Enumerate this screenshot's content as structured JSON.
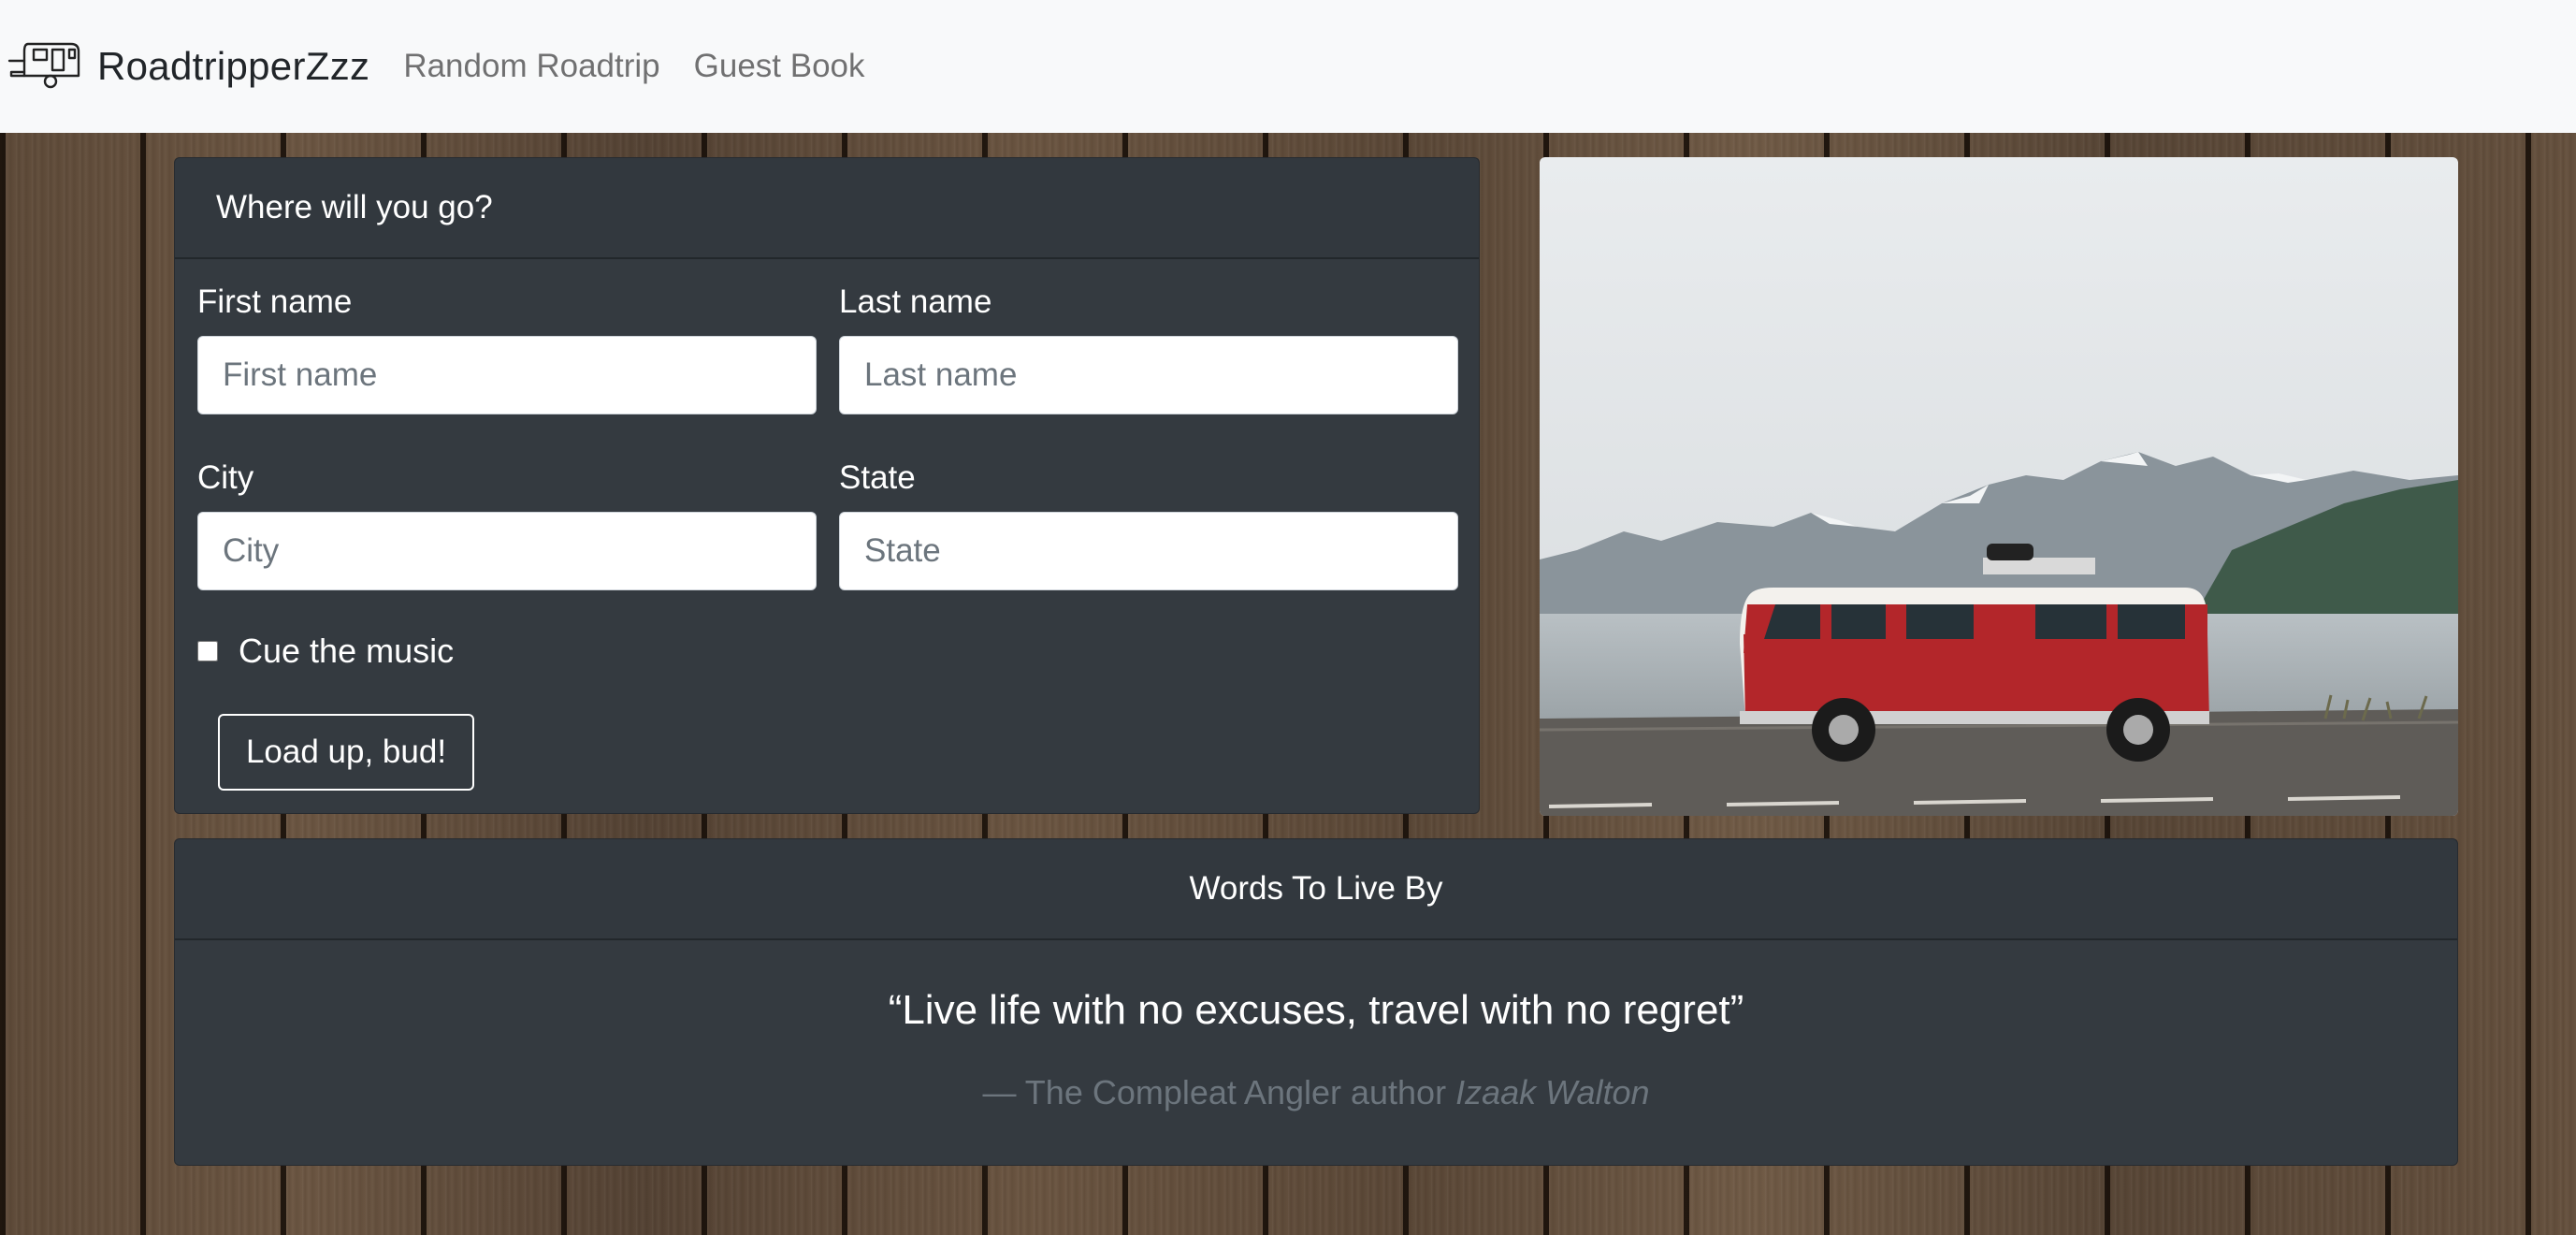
{
  "navbar": {
    "brand": "RoadtripperZzz",
    "links": [
      "Random Roadtrip",
      "Guest Book"
    ]
  },
  "form": {
    "header": "Where will you go?",
    "first_name_label": "First name",
    "first_name_placeholder": "First name",
    "last_name_label": "Last name",
    "last_name_placeholder": "Last name",
    "city_label": "City",
    "city_placeholder": "City",
    "state_label": "State",
    "state_placeholder": "State",
    "checkbox_label": "Cue the music",
    "checkbox_checked": false,
    "submit_label": "Load up, bud!"
  },
  "quote": {
    "header": "Words To Live By",
    "text": "“Live life with no excuses, travel with no regret”",
    "attribution_prefix": "— The Compleat Angler author ",
    "author": "Izaak Walton"
  },
  "colors": {
    "navbar_bg": "#f8f9fa",
    "card_bg": "#343a40",
    "van_red": "#b3262a"
  }
}
